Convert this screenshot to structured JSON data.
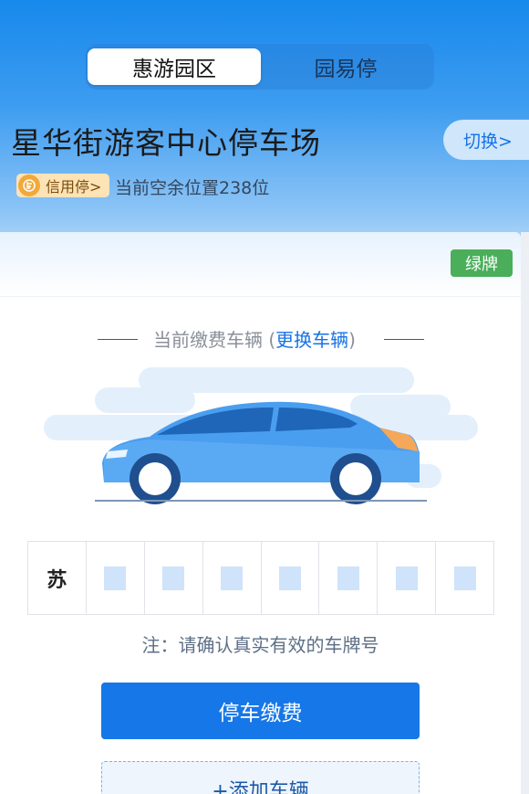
{
  "tabs": [
    {
      "label": "惠游园区",
      "active": true
    },
    {
      "label": "园易停",
      "active": false
    }
  ],
  "parking_lot": {
    "name": "星华街游客中心停车场",
    "switch_label": "切换>",
    "credit_label": "信用停>",
    "available_spaces_text": "当前空余位置238位"
  },
  "vehicle": {
    "plate_type": "绿牌",
    "title_prefix": "当前缴费车辆 (",
    "change_link": "更换车辆",
    "title_suffix": ")",
    "plate_province": "苏",
    "plate_placeholders": 7
  },
  "note": "注：请确认真实有效的车牌号",
  "actions": {
    "pay_label": "停车缴费",
    "add_vehicle_label": "+添加车辆"
  },
  "colors": {
    "primary": "#1677e8",
    "green_plate": "#4aae5b",
    "credit_badge": "#fde3b6"
  }
}
